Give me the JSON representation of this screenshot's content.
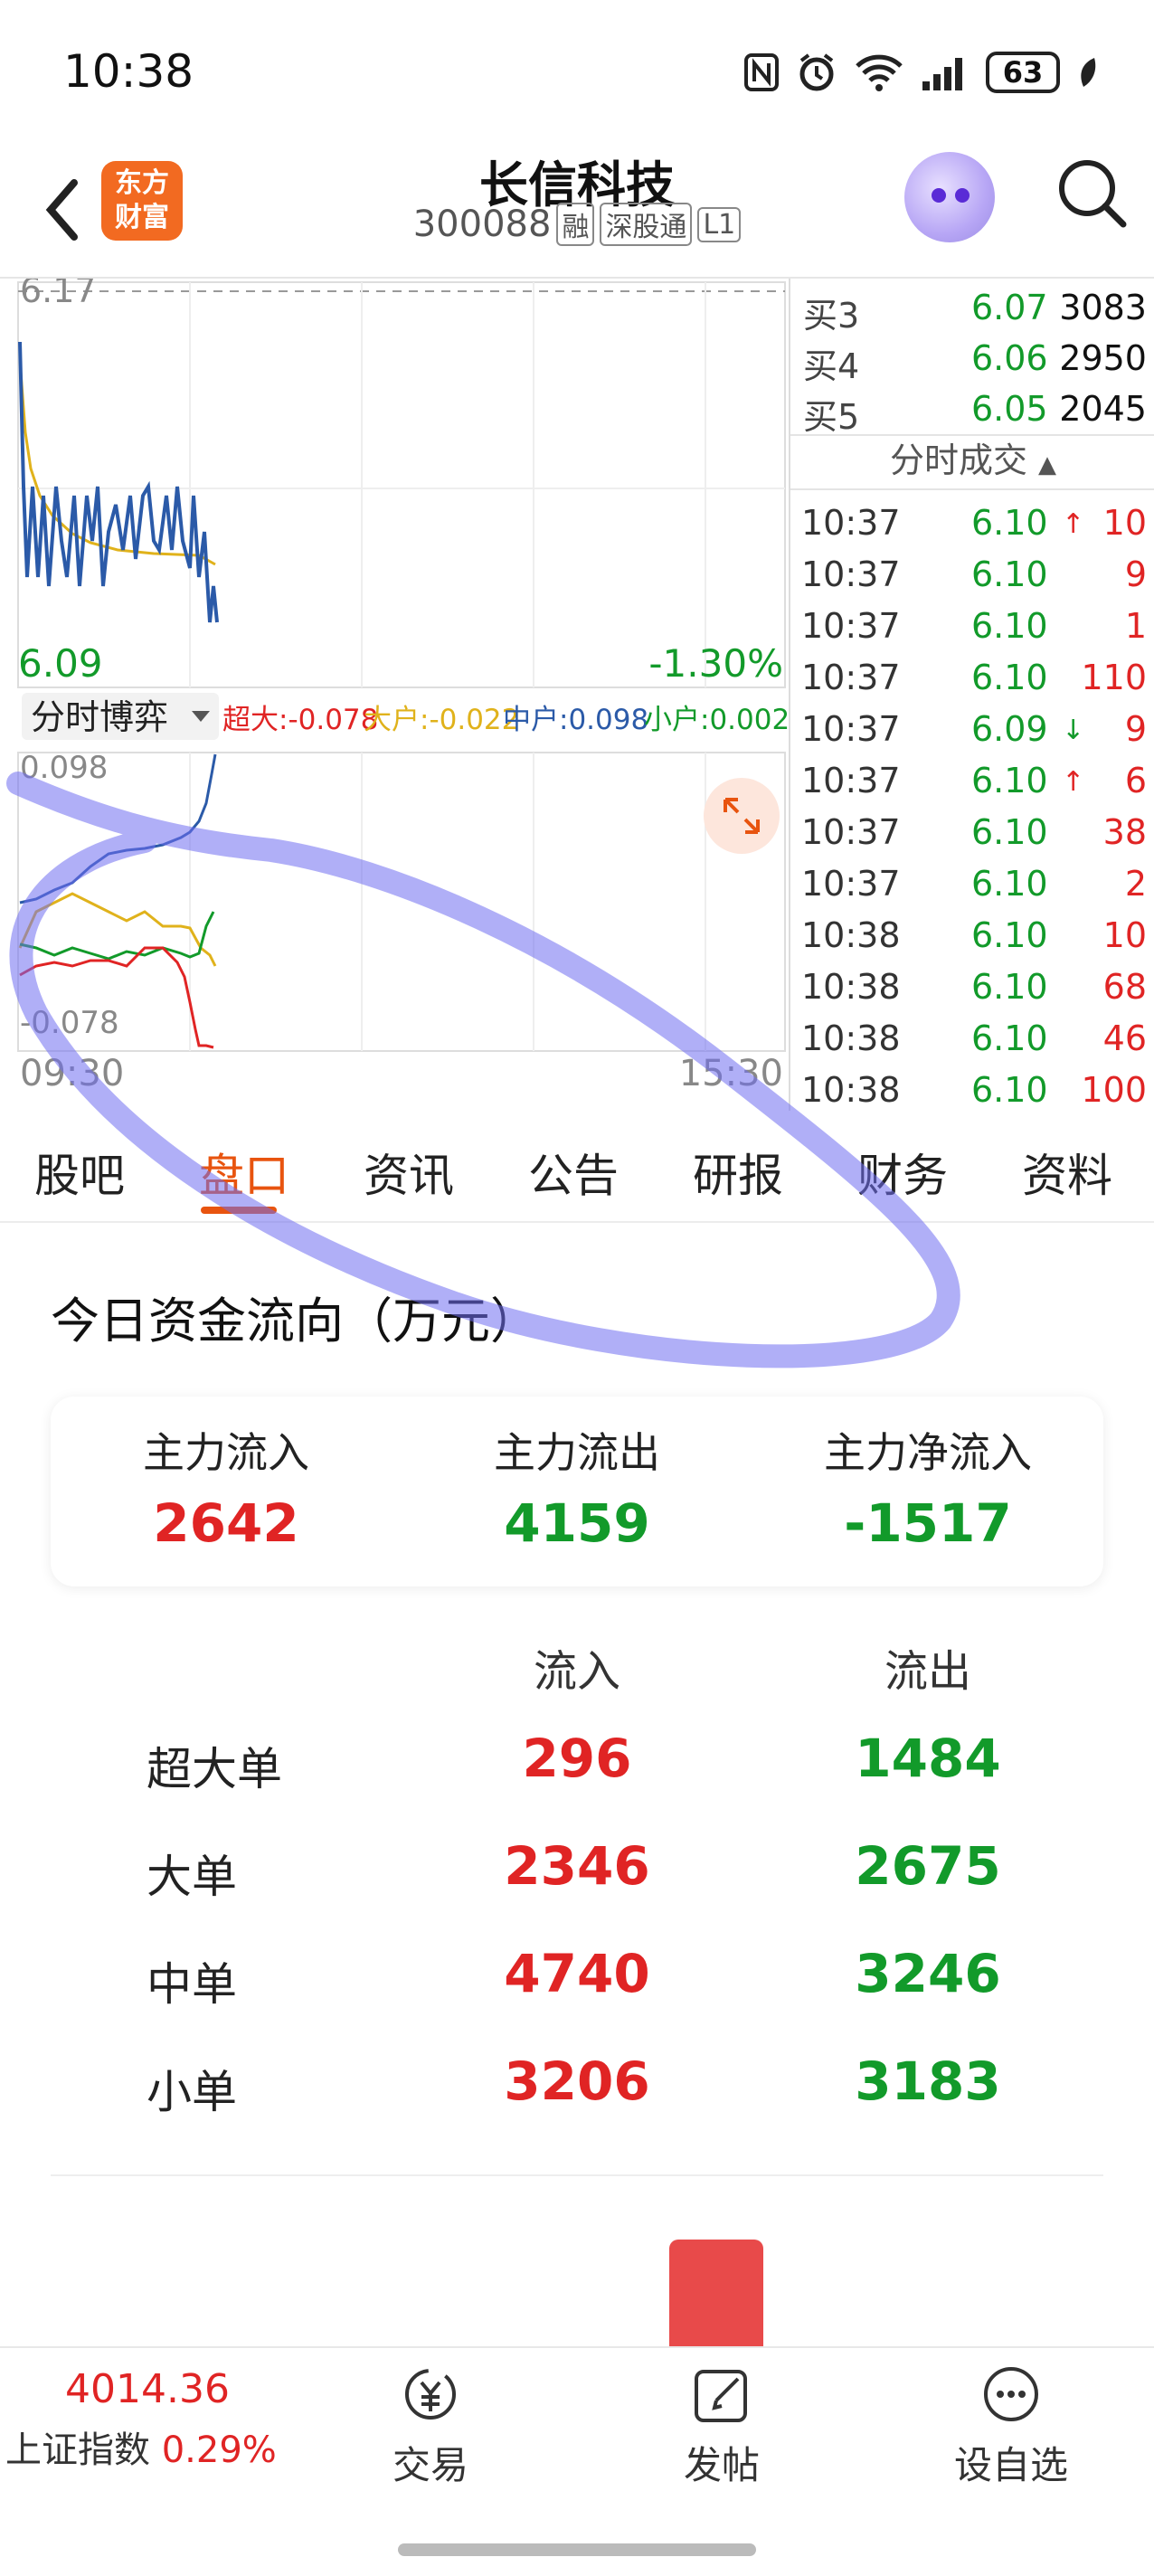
{
  "status_bar": {
    "time": "10:38",
    "battery": "63"
  },
  "header": {
    "logo_line1": "东方",
    "logo_line2": "财富",
    "stock_name": "长信科技",
    "stock_code": "300088",
    "badges": [
      "融",
      "深股通",
      "L1"
    ]
  },
  "chart": {
    "price_high": "6.17",
    "price_low": "6.09",
    "change_pct": "-1.30%",
    "indicator_select": "分时博弈",
    "legend": {
      "super": "超大:-0.078",
      "large": "大户:-0.022",
      "medium": "中户:0.098",
      "small": "小户:0.002"
    },
    "sub_max": "0.098",
    "sub_min": "-0.078",
    "time_start": "09:30",
    "time_end": "15:30",
    "colors": {
      "price": "#2b5aa8",
      "avg": "#e0b21b",
      "super": "#e02424",
      "large": "#e0b21b",
      "medium": "#2b5aa8",
      "small": "#129a2a"
    }
  },
  "orderbook": {
    "bids": [
      {
        "label": "买3",
        "price": "6.07",
        "vol": "3083"
      },
      {
        "label": "买4",
        "price": "6.06",
        "vol": "2950"
      },
      {
        "label": "买5",
        "price": "6.05",
        "vol": "2045"
      }
    ],
    "trades_title": "分时成交",
    "trades": [
      {
        "time": "10:37",
        "price": "6.10",
        "arrow": "↑",
        "vol": "10"
      },
      {
        "time": "10:37",
        "price": "6.10",
        "arrow": "",
        "vol": "9"
      },
      {
        "time": "10:37",
        "price": "6.10",
        "arrow": "",
        "vol": "1"
      },
      {
        "time": "10:37",
        "price": "6.10",
        "arrow": "",
        "vol": "110"
      },
      {
        "time": "10:37",
        "price": "6.09",
        "arrow": "↓",
        "vol": "9"
      },
      {
        "time": "10:37",
        "price": "6.10",
        "arrow": "↑",
        "vol": "6"
      },
      {
        "time": "10:37",
        "price": "6.10",
        "arrow": "",
        "vol": "38"
      },
      {
        "time": "10:37",
        "price": "6.10",
        "arrow": "",
        "vol": "2"
      },
      {
        "time": "10:38",
        "price": "6.10",
        "arrow": "",
        "vol": "10"
      },
      {
        "time": "10:38",
        "price": "6.10",
        "arrow": "",
        "vol": "68"
      },
      {
        "time": "10:38",
        "price": "6.10",
        "arrow": "",
        "vol": "46"
      },
      {
        "time": "10:38",
        "price": "6.10",
        "arrow": "",
        "vol": "100"
      }
    ]
  },
  "tabs": [
    "股吧",
    "盘口",
    "资讯",
    "公告",
    "研报",
    "财务",
    "资料"
  ],
  "active_tab": "盘口",
  "fund_flow": {
    "title": "今日资金流向（万元）",
    "summary": [
      {
        "label": "主力流入",
        "value": "2642"
      },
      {
        "label": "主力流出",
        "value": "4159"
      },
      {
        "label": "主力净流入",
        "value": "-1517"
      }
    ],
    "col_in": "流入",
    "col_out": "流出",
    "rows": [
      {
        "name": "超大单",
        "in": "296",
        "out": "1484"
      },
      {
        "name": "大单",
        "in": "2346",
        "out": "2675"
      },
      {
        "name": "中单",
        "in": "4740",
        "out": "3246"
      },
      {
        "name": "小单",
        "in": "3206",
        "out": "3183"
      }
    ]
  },
  "bottom_bar": {
    "index_value": "4014.36",
    "index_name": "上证指数",
    "index_change": "0.29%",
    "trade_label": "交易",
    "post_label": "发帖",
    "watchlist_label": "设自选"
  }
}
